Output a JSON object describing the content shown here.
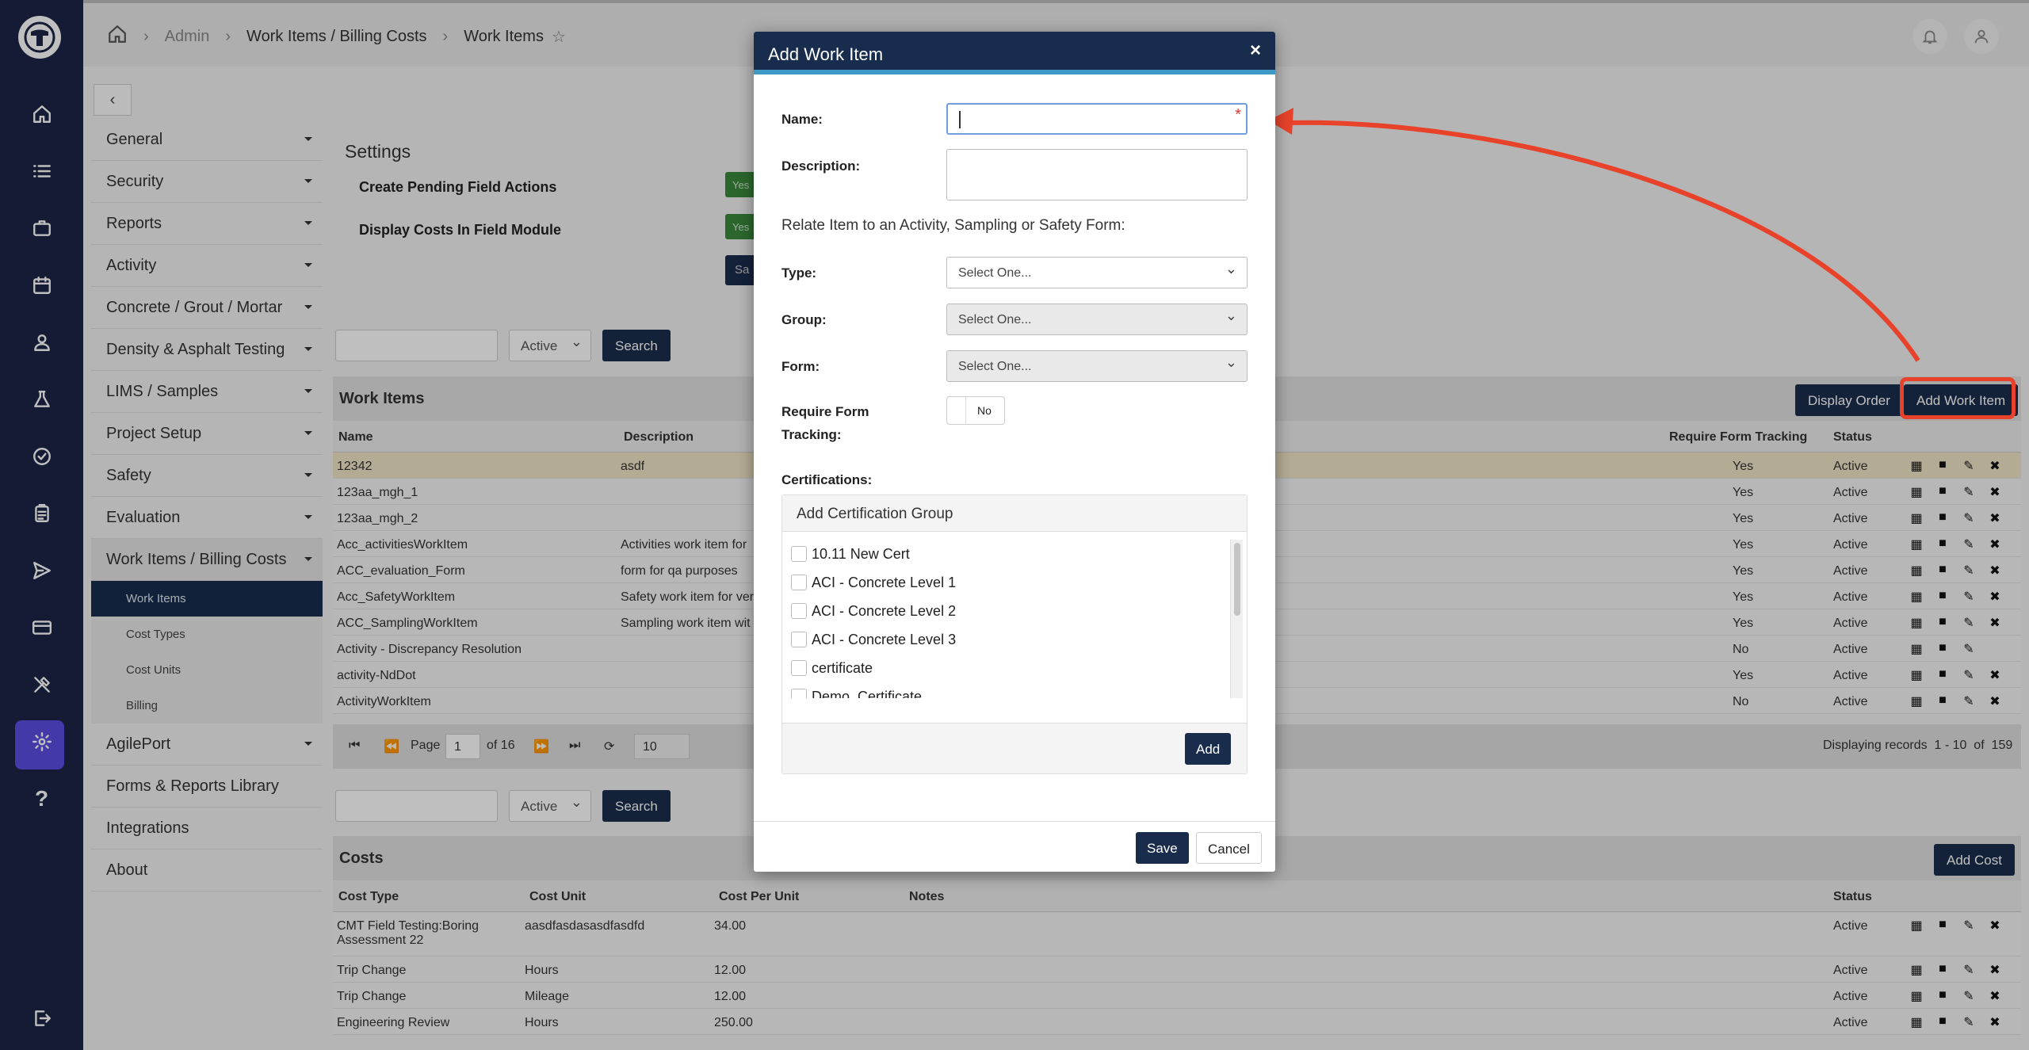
{
  "breadcrumb": {
    "root": "Admin",
    "section": "Work Items / Billing Costs",
    "current": "Work Items"
  },
  "nav": {
    "items": [
      "General",
      "Security",
      "Reports",
      "Activity",
      "Concrete / Grout / Mortar",
      "Density & Asphalt Testing",
      "LIMS / Samples",
      "Project Setup",
      "Safety",
      "Evaluation",
      "Work Items / Billing Costs"
    ],
    "subitems": [
      "Work Items",
      "Cost Types",
      "Cost Units",
      "Billing"
    ],
    "after": [
      "AgilePort",
      "Forms & Reports Library",
      "Integrations",
      "About"
    ]
  },
  "settings": {
    "title": "Settings",
    "rows": [
      "Create Pending Field Actions",
      "Display Costs In Field Module"
    ],
    "yes": "Yes",
    "save": "Sa"
  },
  "filter": {
    "status": "Active",
    "search_button": "Search"
  },
  "work_items": {
    "title": "Work Items",
    "display_order_button": "Display Order",
    "add_button": "Add Work Item",
    "columns": {
      "name": "Name",
      "description": "Description",
      "require": "Require Form Tracking",
      "status": "Status"
    },
    "rows": [
      [
        "12342",
        "asdf",
        "Yes",
        "Active"
      ],
      [
        "123aa_mgh_1",
        "",
        "Yes",
        "Active"
      ],
      [
        "123aa_mgh_2",
        "",
        "Yes",
        "Active"
      ],
      [
        "Acc_activitiesWorkItem",
        "Activities work item for",
        "Yes",
        "Active"
      ],
      [
        "ACC_evaluation_Form",
        "form for qa purposes",
        "Yes",
        "Active"
      ],
      [
        "Acc_SafetyWorkItem",
        "Safety work item for ver",
        "Yes",
        "Active"
      ],
      [
        "ACC_SamplingWorkItem",
        "Sampling work item wit",
        "Yes",
        "Active"
      ],
      [
        "Activity - Discrepancy Resolution",
        "",
        "No",
        "Active"
      ],
      [
        "activity-NdDot",
        "",
        "Yes",
        "Active"
      ],
      [
        "ActivityWorkItem",
        "",
        "No",
        "Active"
      ]
    ],
    "pager": {
      "page_label": "Page",
      "page": "1",
      "of": "of 16",
      "size": "10",
      "displaying": "Displaying records  1 - 10  of  159"
    }
  },
  "costs": {
    "title": "Costs",
    "add_button": "Add Cost",
    "columns": {
      "type": "Cost Type",
      "unit": "Cost Unit",
      "per_unit": "Cost Per Unit",
      "notes": "Notes",
      "status": "Status"
    },
    "rows": [
      [
        "CMT Field Testing:Boring",
        "aasdfasdasasdfasdfd",
        "34.00",
        "Active",
        "Assessment 22"
      ],
      [
        "Trip Change",
        "Hours",
        "12.00",
        "Active",
        ""
      ],
      [
        "Trip Change",
        "Mileage",
        "12.00",
        "Active",
        ""
      ],
      [
        "Engineering Review",
        "Hours",
        "250.00",
        "Active",
        ""
      ]
    ]
  },
  "modal": {
    "title": "Add Work Item",
    "close": "×",
    "name_label": "Name:",
    "name_value": "",
    "required_mark": "*",
    "description_label": "Description:",
    "relate_text": "Relate Item to an Activity, Sampling or Safety Form:",
    "type_label": "Type:",
    "group_label": "Group:",
    "form_label": "Form:",
    "select_placeholder": "Select One...",
    "require_label_1": "Require Form",
    "require_label_2": "Tracking:",
    "toggle_value": "No",
    "certifications_label": "Certifications:",
    "cert_group_title": "Add Certification Group",
    "certs": [
      "10.11 New Cert",
      "ACI - Concrete Level 1",
      "ACI - Concrete Level 2",
      "ACI - Concrete Level 3",
      "certificate",
      "Demo_Certificate"
    ],
    "add_button": "Add",
    "save_button": "Save",
    "cancel_button": "Cancel"
  },
  "colors": {
    "rail": "#1c2446",
    "primary": "#1a2c4c",
    "accent": "#5a4ce0",
    "highlight": "#e8432a"
  }
}
